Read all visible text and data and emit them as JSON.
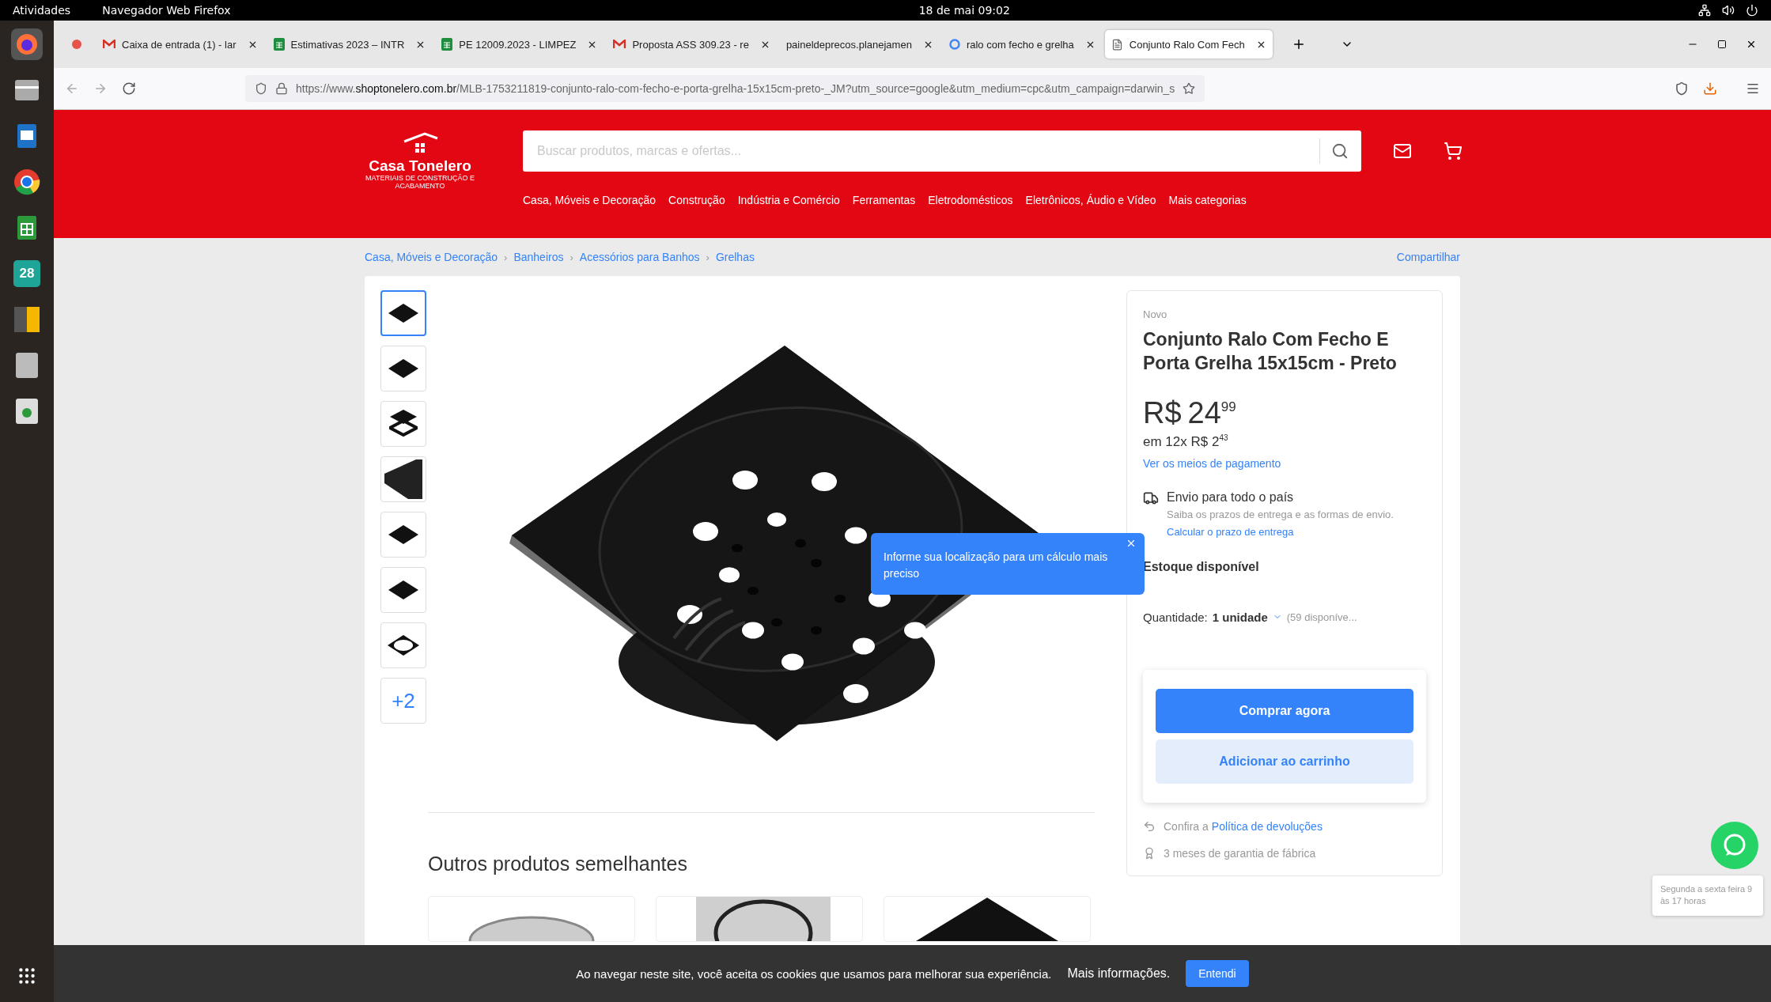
{
  "system_bar": {
    "activities": "Atividades",
    "app_name": "Navegador Web Firefox",
    "clock": "18 de mai 09:02"
  },
  "dock": {
    "calendar_day": "28"
  },
  "browser_tabs": [
    {
      "title": "Caixa de entrada (1) - lar",
      "kind": "mail",
      "selected": false
    },
    {
      "title": "Estimativas 2023 – INTR",
      "kind": "sheet",
      "selected": false
    },
    {
      "title": "PE 12009.2023 - LIMPEZ",
      "kind": "sheet",
      "selected": false
    },
    {
      "title": "Proposta ASS 309.23 - re",
      "kind": "mail",
      "selected": false
    },
    {
      "title": "paineldeprecos.planejamen",
      "kind": "none",
      "selected": false
    },
    {
      "title": "ralo com fecho e grelha",
      "kind": "google",
      "selected": false
    },
    {
      "title": "Conjunto Ralo Com Fech",
      "kind": "page",
      "selected": true
    }
  ],
  "url": "https://www.**shoptonelero.com.br**/MLB-1753211819-conjunto-ralo-com-fecho-e-porta-grelha-15x15cm-preto-_JM?utm_source=google&utm_medium=cpc&utm_campaign=darwin_s",
  "store": {
    "logo_name": "Casa Tonelero",
    "logo_tagline": "MATERIAIS DE CONSTRUÇÃO E ACABAMENTO",
    "search_placeholder": "Buscar produtos, marcas e ofertas...",
    "categories": [
      "Casa, Móveis e Decoração",
      "Construção",
      "Indústria e Comércio",
      "Ferramentas",
      "Eletrodomésticos",
      "Eletrônicos, Áudio e Vídeo",
      "Mais categorias"
    ],
    "breadcrumb": [
      {
        "label": "Casa, Móveis e Decoração"
      },
      {
        "separator": "›",
        "label": "Banheiros"
      },
      {
        "separator": "›",
        "label": "Acessórios para Banhos"
      },
      {
        "separator": "›",
        "label": "Grelhas"
      }
    ],
    "share": "Compartilhar"
  },
  "product": {
    "thumbnails": [
      {
        "kind": "flat",
        "selected": true
      },
      {
        "kind": "flat",
        "selected": false
      },
      {
        "kind": "exploded",
        "selected": false
      },
      {
        "kind": "closeup",
        "selected": false
      },
      {
        "kind": "flat",
        "selected": false
      },
      {
        "kind": "flat",
        "selected": false
      },
      {
        "kind": "ring",
        "selected": false
      }
    ],
    "more_images": "+2",
    "tooltip": "Informe sua localização para um cálculo mais preciso",
    "condition": "Novo",
    "title": "Conjunto Ralo Com Fecho E Porta Grelha 15x15cm - Preto",
    "price_currency": "R$",
    "price_whole": "24",
    "price_cents": "99",
    "installments": "em 12x R$ 2$^{43}$",
    "payment_link": "Ver os meios de pagamento",
    "shipping_title": "Envio para todo o país",
    "shipping_text": "Saiba os prazos de entrega e as formas de envio.",
    "shipping_link": "Calcular o prazo de entrega",
    "stock": "Estoque disponível",
    "quantity_label": "Quantidade:",
    "quantity_value": "1 unidade",
    "quantity_available": "(59 disponíve...",
    "buy_button": "Comprar agora",
    "cart_button": "Adicionar ao carrinho",
    "returns_text": "Confira a",
    "returns_link": "Política de devoluções",
    "warranty": "3 meses de garantia de fábrica"
  },
  "similar": {
    "heading": "Outros produtos semelhantes",
    "items": [
      {
        "kind": "round"
      },
      {
        "kind": "square"
      },
      {
        "kind": "dark"
      }
    ]
  },
  "chat": {
    "hint": "Segunda a sexta feira 9 às 17 horas"
  },
  "cookie": {
    "text": "Ao navegar neste site, você aceita os cookies que usamos para melhorar sua experiência.",
    "link": "Mais informações.",
    "button": "Entendi"
  }
}
